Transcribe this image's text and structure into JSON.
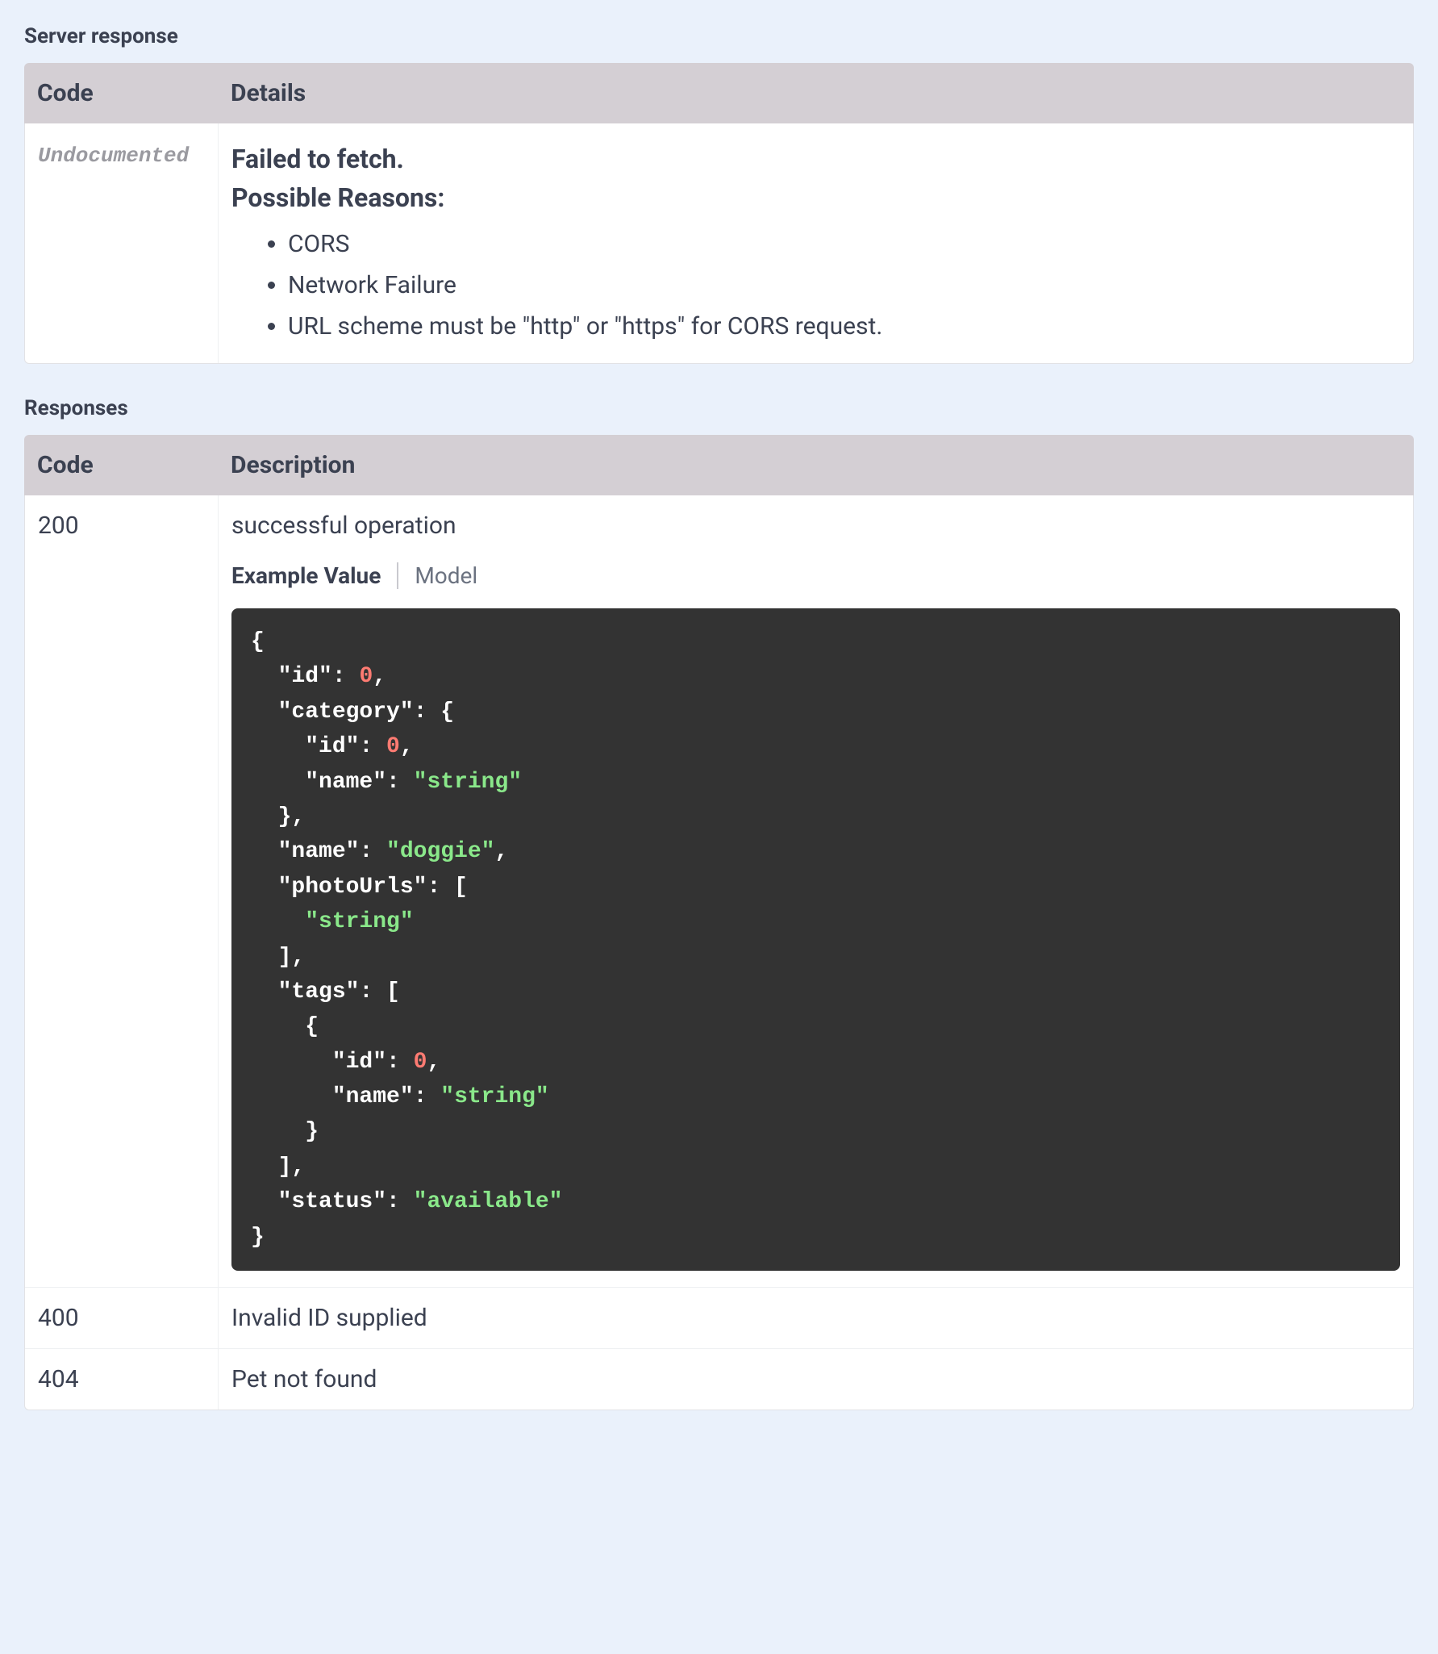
{
  "serverResponse": {
    "title": "Server response",
    "header_code": "Code",
    "header_details": "Details",
    "row": {
      "code": "Undocumented",
      "fail_fetch": "Failed to fetch.",
      "possible_reasons": "Possible Reasons:",
      "reasons": [
        "CORS",
        "Network Failure",
        "URL scheme must be \"http\" or \"https\" for CORS request."
      ]
    }
  },
  "responses": {
    "title": "Responses",
    "header_code": "Code",
    "header_desc": "Description",
    "rows": [
      {
        "code": "200",
        "desc": "successful operation",
        "tabs": {
          "example": "Example Value",
          "model": "Model"
        },
        "example_json": {
          "id": 0,
          "category": {
            "id": 0,
            "name": "string"
          },
          "name": "doggie",
          "photoUrls": [
            "string"
          ],
          "tags": [
            {
              "id": 0,
              "name": "string"
            }
          ],
          "status": "available"
        }
      },
      {
        "code": "400",
        "desc": "Invalid ID supplied"
      },
      {
        "code": "404",
        "desc": "Pet not found"
      }
    ]
  }
}
